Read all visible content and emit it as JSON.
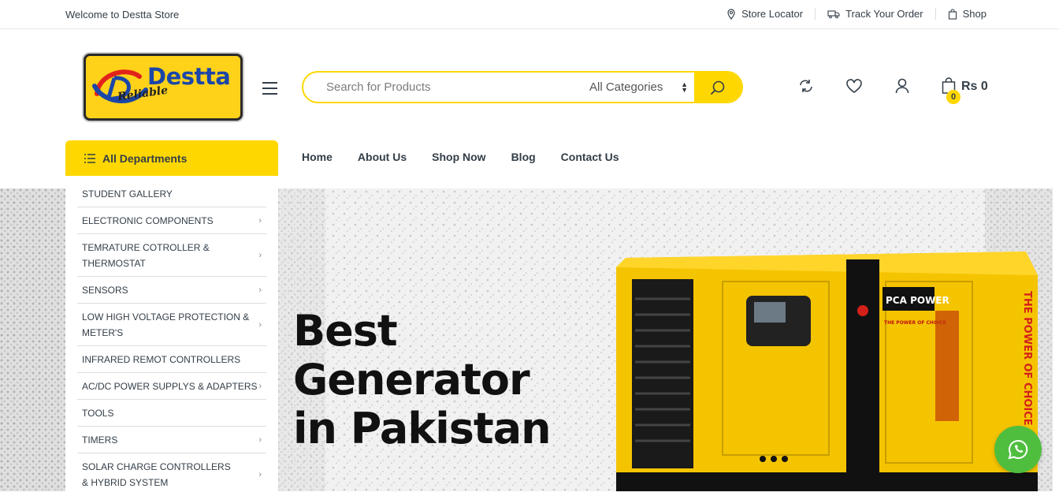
{
  "topbar": {
    "welcome": "Welcome to Destta Store",
    "links": [
      {
        "label": "Store Locator",
        "icon": "map-pin-icon"
      },
      {
        "label": "Track Your Order",
        "icon": "truck-icon"
      },
      {
        "label": "Shop",
        "icon": "shopping-bag-icon"
      }
    ]
  },
  "logo": {
    "brand": "Destta",
    "tagline": "Reliable"
  },
  "search": {
    "placeholder": "Search for Products",
    "category": "All Categories"
  },
  "header_icons": [
    "compare-icon",
    "heart-icon",
    "user-icon"
  ],
  "cart": {
    "count": "0",
    "total": "Rs 0"
  },
  "departments": {
    "label": "All Departments",
    "items": [
      {
        "label": "STUDENT GALLERY",
        "has_sub": false
      },
      {
        "label": "ELECTRONIC COMPONENTS",
        "has_sub": true
      },
      {
        "label": "TEMRATURE COTROLLER & THERMOSTAT",
        "has_sub": true
      },
      {
        "label": "SENSORS",
        "has_sub": true
      },
      {
        "label": "LOW HIGH VOLTAGE PROTECTION & METER'S",
        "has_sub": true
      },
      {
        "label": "INFRARED REMOT CONTROLLERS",
        "has_sub": false
      },
      {
        "label": "AC/DC POWER SUPPLYS & ADAPTERS",
        "has_sub": true
      },
      {
        "label": "TOOLS",
        "has_sub": false
      },
      {
        "label": "TIMERS",
        "has_sub": true
      },
      {
        "label": "SOLAR CHARGE CONTROLLERS & HYBRID SYSTEM",
        "has_sub": true
      }
    ]
  },
  "nav": [
    "Home",
    "About Us",
    "Shop Now",
    "Blog",
    "Contact Us"
  ],
  "hero": {
    "line1": "Best",
    "line2": "Generator",
    "line3": "in Pakistan",
    "product_brand": "PCA POWER",
    "product_slogan": "THE POWER OF CHOICE",
    "side_text": "THE POWER OF CHOICE"
  },
  "colors": {
    "accent": "#fed700",
    "text": "#333e48",
    "whatsapp": "#4fbe3f"
  }
}
